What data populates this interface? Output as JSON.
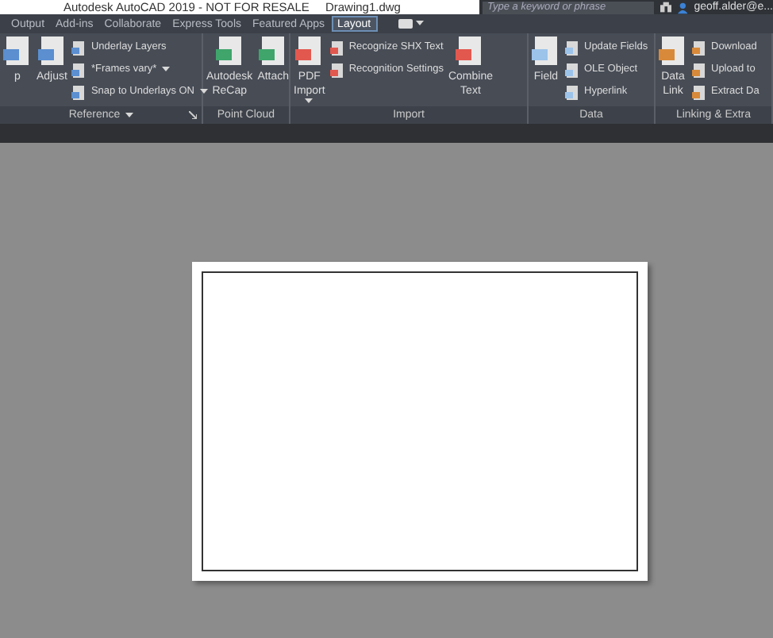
{
  "title_bar": {
    "title": "Autodesk AutoCAD 2019 - NOT FOR RESALE",
    "file": "Drawing1.dwg",
    "search": {
      "placeholder": "Type a keyword or phrase"
    },
    "user": "geoff.alder@e..."
  },
  "tabs": [
    {
      "label": "Output",
      "selected": false
    },
    {
      "label": "Add-ins",
      "selected": false
    },
    {
      "label": "Collaborate",
      "selected": false
    },
    {
      "label": "Express Tools",
      "selected": false
    },
    {
      "label": "Featured Apps",
      "selected": false
    },
    {
      "label": "Layout",
      "selected": true
    }
  ],
  "panels": [
    {
      "label": "Reference",
      "menu": true,
      "launcher": true,
      "items": [
        {
          "kind": "large",
          "lines": [
            "p"
          ]
        },
        {
          "kind": "large",
          "lines": [
            "Adjust"
          ]
        },
        {
          "kind": "small",
          "label": "Underlay Layers"
        },
        {
          "kind": "small",
          "label": "*Frames vary*",
          "dropdown": true
        },
        {
          "kind": "small",
          "label": "Snap to Underlays ON",
          "dropdown": true
        }
      ]
    },
    {
      "label": "Point Cloud",
      "menu": false,
      "launcher": false,
      "items": [
        {
          "kind": "large",
          "lines": [
            "Autodesk",
            "ReCap"
          ]
        },
        {
          "kind": "large",
          "lines": [
            "Attach"
          ]
        }
      ]
    },
    {
      "label": "Import",
      "menu": false,
      "launcher": false,
      "items": [
        {
          "kind": "large",
          "lines": [
            "PDF",
            "Import"
          ],
          "dropdown": true
        },
        {
          "kind": "small",
          "label": "Recognize SHX Text"
        },
        {
          "kind": "small",
          "label": "Recognition Settings"
        },
        {
          "kind": "large",
          "lines": [
            "Combine",
            "Text"
          ]
        }
      ]
    },
    {
      "label": "Data",
      "menu": false,
      "launcher": false,
      "items": [
        {
          "kind": "large",
          "lines": [
            "Field"
          ]
        },
        {
          "kind": "small",
          "label": "Update Fields"
        },
        {
          "kind": "small",
          "label": "OLE Object"
        },
        {
          "kind": "small",
          "label": "Hyperlink"
        }
      ]
    },
    {
      "label": "Linking & Extra",
      "menu": false,
      "launcher": false,
      "items": [
        {
          "kind": "large",
          "lines": [
            "Data",
            "Link"
          ]
        },
        {
          "kind": "small",
          "label": "Download"
        },
        {
          "kind": "small",
          "label": "Upload to"
        },
        {
          "kind": "small",
          "label": "Extract Da"
        }
      ]
    }
  ]
}
